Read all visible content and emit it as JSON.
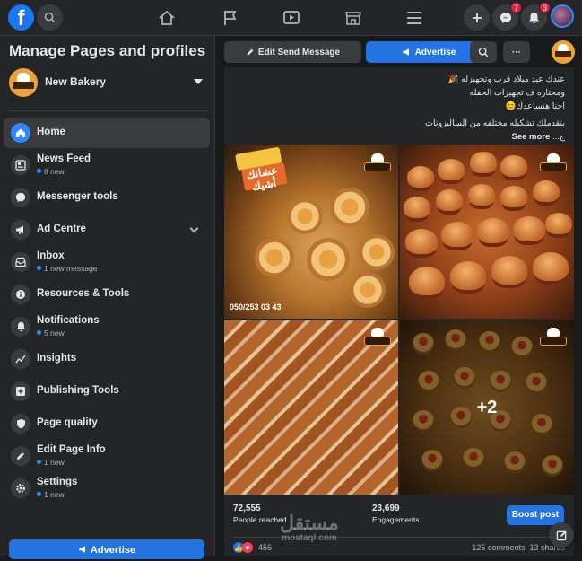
{
  "topbar": {
    "logo": "f",
    "badges": {
      "messenger": "7",
      "notifications": "3"
    },
    "icons": [
      "search-icon",
      "home-icon",
      "flag-icon",
      "video-icon",
      "marketplace-icon",
      "menu-icon",
      "plus-icon",
      "messenger-icon",
      "bell-icon"
    ]
  },
  "sidebar": {
    "title": "Manage Pages and profiles",
    "page_name": "New Bakery",
    "items": [
      {
        "label": "Home",
        "sub": ""
      },
      {
        "label": "News Feed",
        "sub": "8 new"
      },
      {
        "label": "Messenger tools",
        "sub": ""
      },
      {
        "label": "Ad Centre",
        "sub": ""
      },
      {
        "label": "Inbox",
        "sub": "1 new message"
      },
      {
        "label": "Resources & Tools",
        "sub": ""
      },
      {
        "label": "Notifications",
        "sub": "5 new"
      },
      {
        "label": "Insights",
        "sub": ""
      },
      {
        "label": "Publishing Tools",
        "sub": ""
      },
      {
        "label": "Page quality",
        "sub": ""
      },
      {
        "label": "Edit Page Info",
        "sub": "1 new"
      },
      {
        "label": "Settings",
        "sub": "1 new"
      }
    ],
    "advertise_label": "Advertise"
  },
  "toolbar": {
    "edit_send_label": "Edit Send Message",
    "advertise_label": "Advertise",
    "more_label": "···"
  },
  "post": {
    "caption_lines": [
      "عندك عيد ميلاد قرب وتجهيزله 🎉",
      "ومحتاره ف تجهيزات الحفله",
      "احنا هنساعدك😊",
      "بنقدملك تشكيله مختلفه من الساليزونات",
      "ج..."
    ],
    "see_more": "See more",
    "phone": "050/253 03 43",
    "photo_text": "عشانك أشيك",
    "more_photos": "+2",
    "stats": {
      "reached_value": "72,555",
      "reached_label": "People reached",
      "engagements_value": "23,699",
      "engagements_label": "Engagements"
    },
    "boost_label": "Boost post",
    "reaction_count": "456",
    "comments": "125 comments",
    "shares": "13 shares"
  },
  "watermark": {
    "arabic": "مستقل",
    "latin": "mostaql.com"
  },
  "colors": {
    "accent": "#2374e1",
    "badge": "#e41e3f",
    "bg": "#18191a",
    "panel": "#242526"
  }
}
